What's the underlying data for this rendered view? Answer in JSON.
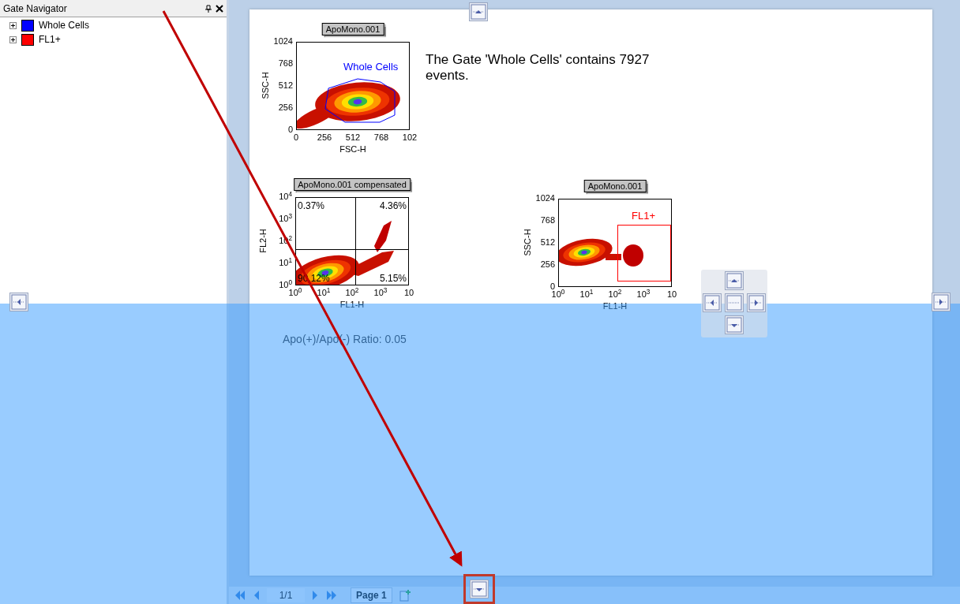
{
  "panel": {
    "title": "Gate Navigator",
    "gates": [
      {
        "label": "Whole Cells",
        "color": "#0000ff",
        "expanded": false
      },
      {
        "label": "FL1+",
        "color": "#ff0000",
        "expanded": false
      }
    ]
  },
  "plots": [
    {
      "kind": "gated",
      "title": "ApoMono.001",
      "x_label": "FSC-H",
      "y_label": "SSC-H",
      "x_ticks": [
        "0",
        "256",
        "512",
        "768",
        "102"
      ],
      "y_ticks": [
        "1024",
        "768",
        "512",
        "256",
        "0"
      ],
      "gate": {
        "kind": "polygon",
        "label": "Whole Cells",
        "color": "#0000ff"
      }
    },
    {
      "kind": "quadrant",
      "title": "ApoMono.001 compensated",
      "x_label": "FL1-H",
      "y_label": "FL2-H",
      "x_ticks": [
        "10$^{0}$",
        "10$^{1}$",
        "10$^{2}$",
        "10$^{3}$",
        "10"
      ],
      "y_ticks": [
        "10$^{4}$",
        "10$^{3}$",
        "10$^{2}$",
        "10$^{1}$",
        "10$^{0}$"
      ],
      "quadrants": [
        "0.37%",
        "4.36%",
        "90.12%",
        "5.15%"
      ]
    },
    {
      "kind": "gated",
      "title": "ApoMono.001",
      "x_label": "FL1-H",
      "y_label": "SSC-H",
      "x_ticks": [
        "10$^{0}$",
        "10$^{1}$",
        "10$^{2}$",
        "10$^{3}$",
        "10"
      ],
      "y_ticks": [
        "1024",
        "768",
        "512",
        "256",
        "0"
      ],
      "gate": {
        "kind": "rect",
        "label": "FL1+",
        "color": "#ff0000"
      }
    }
  ],
  "gate_info": "The Gate 'Whole Cells' contains 7927 events.",
  "ratio": "Apo(+)/Apo(-) Ratio: 0.05",
  "pager": {
    "position": "1/1",
    "tabs": [
      {
        "label": "Page 1",
        "selected": true
      }
    ]
  }
}
